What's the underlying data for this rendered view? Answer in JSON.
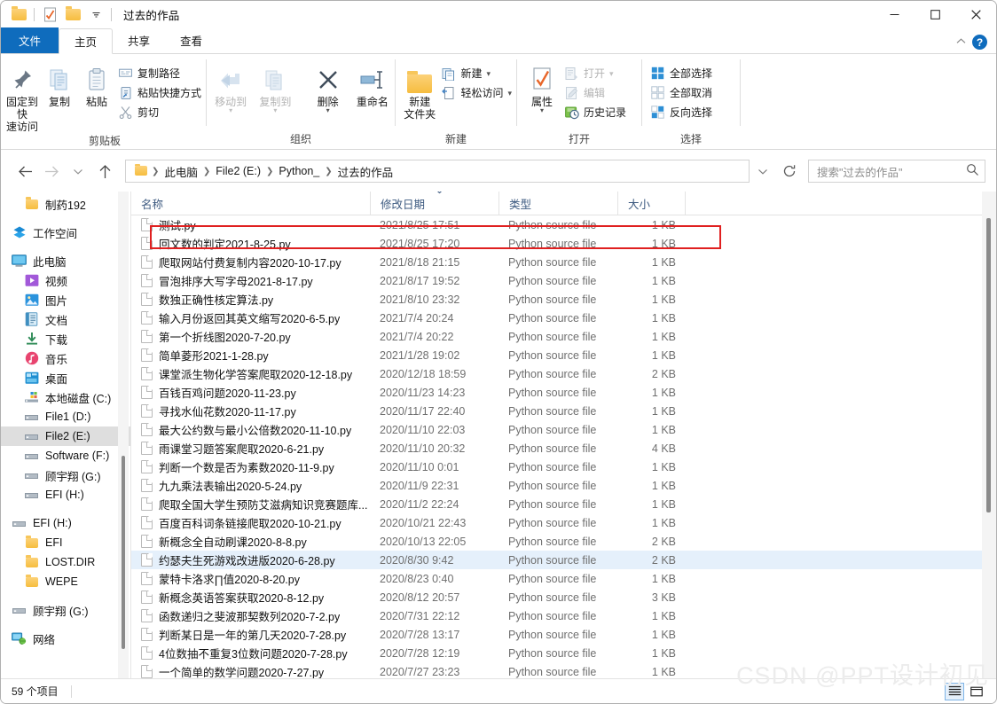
{
  "window": {
    "title": "过去的作品",
    "quick_access": [
      "folder-icon",
      "properties-icon",
      "new-folder-icon",
      "chevron-down-icon"
    ],
    "controls": {
      "minimize": "—",
      "maximize": "□",
      "close": "✕"
    }
  },
  "tabs": [
    {
      "label": "文件",
      "type": "file"
    },
    {
      "label": "主页",
      "type": "active"
    },
    {
      "label": "共享",
      "type": "normal"
    },
    {
      "label": "查看",
      "type": "normal"
    }
  ],
  "ribbon": {
    "collapse_icon": "chevron-up-icon",
    "help_icon": "help-icon",
    "groups": [
      {
        "label": "剪贴板",
        "big_buttons": [
          {
            "label": "固定到快\n速访问",
            "icon": "pin-icon",
            "dim": false
          },
          {
            "label": "复制",
            "icon": "copy-icon",
            "dim": false
          },
          {
            "label": "粘贴",
            "icon": "paste-icon",
            "dim": false,
            "caret": true
          }
        ],
        "small_buttons": [
          {
            "label": "复制路径",
            "icon": "copy-path-icon",
            "dim": false
          },
          {
            "label": "粘贴快捷方式",
            "icon": "paste-shortcut-icon",
            "dim": false
          },
          {
            "label": "剪切",
            "icon": "scissors-icon",
            "dim": false
          }
        ]
      },
      {
        "label": "组织",
        "big_buttons": [
          {
            "label": "移动到",
            "icon": "move-to-icon",
            "dim": true,
            "caret": true
          },
          {
            "label": "复制到",
            "icon": "copy-to-icon",
            "dim": true,
            "caret": true
          },
          {
            "label": "删除",
            "icon": "delete-icon",
            "dim": false,
            "caret": true
          },
          {
            "label": "重命名",
            "icon": "rename-icon",
            "dim": false
          }
        ],
        "small_buttons": []
      },
      {
        "label": "新建",
        "big_buttons": [
          {
            "label": "新建\n文件夹",
            "icon": "new-folder-icon",
            "dim": false
          }
        ],
        "small_buttons": [
          {
            "label": "新建",
            "icon": "new-item-icon",
            "dim": false,
            "caret": true
          },
          {
            "label": "轻松访问",
            "icon": "easy-access-icon",
            "dim": false,
            "caret": true
          }
        ]
      },
      {
        "label": "打开",
        "big_buttons": [
          {
            "label": "属性",
            "icon": "properties-icon",
            "dim": false,
            "caret": true
          }
        ],
        "small_buttons": [
          {
            "label": "打开",
            "icon": "open-icon",
            "dim": true,
            "caret": true
          },
          {
            "label": "编辑",
            "icon": "edit-icon",
            "dim": true
          },
          {
            "label": "历史记录",
            "icon": "history-icon",
            "dim": false
          }
        ]
      },
      {
        "label": "选择",
        "big_buttons": [],
        "small_buttons": [
          {
            "label": "全部选择",
            "icon": "select-all-icon",
            "dim": false
          },
          {
            "label": "全部取消",
            "icon": "select-none-icon",
            "dim": false
          },
          {
            "label": "反向选择",
            "icon": "invert-selection-icon",
            "dim": false
          }
        ]
      }
    ]
  },
  "address": {
    "back_icon": "arrow-left-icon",
    "forward_icon": "arrow-right-icon",
    "recent_icon": "chevron-down-icon",
    "up_icon": "arrow-up-icon",
    "breadcrumb": [
      "此电脑",
      "File2 (E:)",
      "Python_",
      "过去的作品"
    ],
    "history_dropdown_icon": "chevron-down-icon",
    "refresh_icon": "refresh-icon",
    "search_placeholder": "搜索\"过去的作品\"",
    "search_icon": "search-icon"
  },
  "sidebar": {
    "items": [
      {
        "label": "制药192",
        "icon": "folder-icon",
        "indent": 1,
        "selected": false
      },
      {
        "label": "工作空间",
        "icon": "workspace-icon",
        "indent": 0,
        "selected": false,
        "gap_before": true
      },
      {
        "label": "此电脑",
        "icon": "this-pc-icon",
        "indent": 0,
        "selected": false,
        "gap_before": true
      },
      {
        "label": "视频",
        "icon": "videos-icon",
        "indent": 1,
        "selected": false
      },
      {
        "label": "图片",
        "icon": "pictures-icon",
        "indent": 1,
        "selected": false
      },
      {
        "label": "文档",
        "icon": "documents-icon",
        "indent": 1,
        "selected": false
      },
      {
        "label": "下载",
        "icon": "downloads-icon",
        "indent": 1,
        "selected": false
      },
      {
        "label": "音乐",
        "icon": "music-icon",
        "indent": 1,
        "selected": false
      },
      {
        "label": "桌面",
        "icon": "desktop-icon",
        "indent": 1,
        "selected": false
      },
      {
        "label": "本地磁盘 (C:)",
        "icon": "system-drive-icon",
        "indent": 1,
        "selected": false
      },
      {
        "label": "File1 (D:)",
        "icon": "drive-icon",
        "indent": 1,
        "selected": false
      },
      {
        "label": "File2 (E:)",
        "icon": "drive-icon",
        "indent": 1,
        "selected": true
      },
      {
        "label": "Software (F:)",
        "icon": "drive-icon",
        "indent": 1,
        "selected": false
      },
      {
        "label": "顾宇翔 (G:)",
        "icon": "drive-icon",
        "indent": 1,
        "selected": false
      },
      {
        "label": "EFI (H:)",
        "icon": "drive-icon",
        "indent": 1,
        "selected": false
      },
      {
        "label": "EFI (H:)",
        "icon": "drive-icon",
        "indent": 0,
        "selected": false,
        "gap_before": true
      },
      {
        "label": "EFI",
        "icon": "folder-icon",
        "indent": 1,
        "selected": false
      },
      {
        "label": "LOST.DIR",
        "icon": "folder-icon",
        "indent": 1,
        "selected": false
      },
      {
        "label": "WEPE",
        "icon": "folder-icon",
        "indent": 1,
        "selected": false
      },
      {
        "label": "顾宇翔 (G:)",
        "icon": "drive-icon",
        "indent": 0,
        "selected": false,
        "gap_before": true
      },
      {
        "label": "网络",
        "icon": "network-icon",
        "indent": 0,
        "selected": false,
        "gap_before": true
      }
    ]
  },
  "filelist": {
    "columns": [
      {
        "key": "name",
        "label": "名称"
      },
      {
        "key": "date",
        "label": "修改日期",
        "sorted": true
      },
      {
        "key": "type",
        "label": "类型"
      },
      {
        "key": "size",
        "label": "大小"
      }
    ],
    "rows": [
      {
        "name": "测试.py",
        "date": "2021/8/25 17:51",
        "type": "Python source file",
        "size": "1 KB",
        "selected": false,
        "highlighted": true
      },
      {
        "name": "回文数的判定2021-8-25.py",
        "date": "2021/8/25 17:20",
        "type": "Python source file",
        "size": "1 KB",
        "selected": false
      },
      {
        "name": "爬取网站付费复制内容2020-10-17.py",
        "date": "2021/8/18 21:15",
        "type": "Python source file",
        "size": "1 KB",
        "selected": false
      },
      {
        "name": "冒泡排序大写字母2021-8-17.py",
        "date": "2021/8/17 19:52",
        "type": "Python source file",
        "size": "1 KB",
        "selected": false
      },
      {
        "name": "数独正确性核定算法.py",
        "date": "2021/8/10 23:32",
        "type": "Python source file",
        "size": "1 KB",
        "selected": false
      },
      {
        "name": "输入月份返回其英文缩写2020-6-5.py",
        "date": "2021/7/4 20:24",
        "type": "Python source file",
        "size": "1 KB",
        "selected": false
      },
      {
        "name": "第一个折线图2020-7-20.py",
        "date": "2021/7/4 20:22",
        "type": "Python source file",
        "size": "1 KB",
        "selected": false
      },
      {
        "name": "简单菱形2021-1-28.py",
        "date": "2021/1/28 19:02",
        "type": "Python source file",
        "size": "1 KB",
        "selected": false
      },
      {
        "name": "课堂派生物化学答案爬取2020-12-18.py",
        "date": "2020/12/18 18:59",
        "type": "Python source file",
        "size": "2 KB",
        "selected": false
      },
      {
        "name": "百钱百鸡问题2020-11-23.py",
        "date": "2020/11/23 14:23",
        "type": "Python source file",
        "size": "1 KB",
        "selected": false
      },
      {
        "name": "寻找水仙花数2020-11-17.py",
        "date": "2020/11/17 22:40",
        "type": "Python source file",
        "size": "1 KB",
        "selected": false
      },
      {
        "name": "最大公约数与最小公倍数2020-11-10.py",
        "date": "2020/11/10 22:03",
        "type": "Python source file",
        "size": "1 KB",
        "selected": false
      },
      {
        "name": "雨课堂习题答案爬取2020-6-21.py",
        "date": "2020/11/10 20:32",
        "type": "Python source file",
        "size": "4 KB",
        "selected": false
      },
      {
        "name": "判断一个数是否为素数2020-11-9.py",
        "date": "2020/11/10 0:01",
        "type": "Python source file",
        "size": "1 KB",
        "selected": false
      },
      {
        "name": "九九乘法表输出2020-5-24.py",
        "date": "2020/11/9 22:31",
        "type": "Python source file",
        "size": "1 KB",
        "selected": false
      },
      {
        "name": "爬取全国大学生预防艾滋病知识竞赛题库...",
        "date": "2020/11/2 22:24",
        "type": "Python source file",
        "size": "1 KB",
        "selected": false
      },
      {
        "name": "百度百科词条链接爬取2020-10-21.py",
        "date": "2020/10/21 22:43",
        "type": "Python source file",
        "size": "1 KB",
        "selected": false
      },
      {
        "name": "新概念全自动刷课2020-8-8.py",
        "date": "2020/10/13 22:05",
        "type": "Python source file",
        "size": "2 KB",
        "selected": false
      },
      {
        "name": "约瑟夫生死游戏改进版2020-6-28.py",
        "date": "2020/8/30 9:42",
        "type": "Python source file",
        "size": "2 KB",
        "selected": true
      },
      {
        "name": "蒙特卡洛求∏值2020-8-20.py",
        "date": "2020/8/23 0:40",
        "type": "Python source file",
        "size": "1 KB",
        "selected": false
      },
      {
        "name": "新概念英语答案获取2020-8-12.py",
        "date": "2020/8/12 20:57",
        "type": "Python source file",
        "size": "3 KB",
        "selected": false
      },
      {
        "name": "函数递归之斐波那契数列2020-7-2.py",
        "date": "2020/7/31 22:12",
        "type": "Python source file",
        "size": "1 KB",
        "selected": false
      },
      {
        "name": "判断某日是一年的第几天2020-7-28.py",
        "date": "2020/7/28 13:17",
        "type": "Python source file",
        "size": "1 KB",
        "selected": false
      },
      {
        "name": "4位数抽不重复3位数问题2020-7-28.py",
        "date": "2020/7/28 12:19",
        "type": "Python source file",
        "size": "1 KB",
        "selected": false
      },
      {
        "name": "一个简单的数学问题2020-7-27.py",
        "date": "2020/7/27 23:23",
        "type": "Python source file",
        "size": "1 KB",
        "selected": false
      }
    ]
  },
  "status": {
    "item_count": "59 个项目",
    "view_details_icon": "details-view-icon",
    "view_tiles_icon": "tiles-view-icon"
  },
  "watermark": "CSDN @PPT设计初见"
}
